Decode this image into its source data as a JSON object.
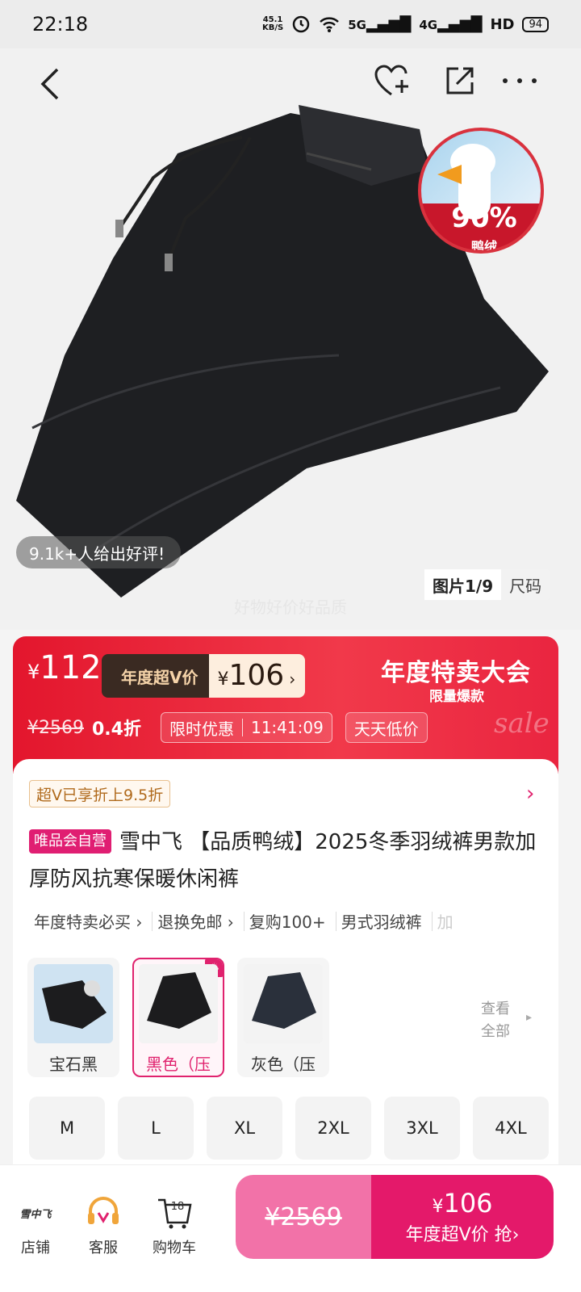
{
  "status_bar": {
    "time": "22:18",
    "net_speed_top": "45.1",
    "net_speed_bottom": "KB/S",
    "signal1": "5G",
    "signal2": "4G",
    "hd": "HD",
    "battery": "94"
  },
  "hero": {
    "review_text": "9.1k+人给出好评!",
    "badge_percent": "90%",
    "badge_text": "鸭绒",
    "tabs": [
      "图片1/9",
      "尺码"
    ],
    "watermark": "好物好价好品质"
  },
  "price": {
    "yen": "¥",
    "current": "112",
    "vip_label": "年度超V价",
    "vip_price": "106",
    "vip_chevron": "›",
    "event_title": "年度特卖大会",
    "event_sub": "限量爆款",
    "event_script": "sale",
    "original": "¥2569",
    "discount": "0.4折",
    "promo_label": "限时优惠",
    "countdown": "11:41:09",
    "promo_tag": "天天低价"
  },
  "product": {
    "vip_discount": "超V已享折上9.5折",
    "store_tag": "唯品会自营",
    "title": "雪中飞 【品质鸭绒】2025冬季羽绒裤男款加厚防风抗寒保暖休闲裤",
    "tags": [
      "年度特卖必买 ›",
      "退换免邮 ›",
      "复购100+",
      "男式羽绒裤",
      "加"
    ],
    "colors": [
      {
        "label": "宝石黑",
        "selected": false
      },
      {
        "label": "黑色（压",
        "selected": true
      },
      {
        "label": "灰色（压",
        "selected": false
      }
    ],
    "view_all": "查看全部",
    "sizes": [
      "M",
      "L",
      "XL",
      "2XL",
      "3XL",
      "4XL"
    ]
  },
  "bottom_bar": {
    "shop_label": "店铺",
    "shop_logo": "雪中飞",
    "service_label": "客服",
    "cart_label": "购物车",
    "cart_count": "18",
    "buy_original": "¥2569",
    "buy_yen": "¥",
    "buy_price": "106",
    "buy_cta": "年度超V价 抢›"
  },
  "colors": {
    "brand_pink": "#e0226e",
    "banner_red": "#e3162d",
    "buy_light": "#f272a8",
    "buy_dark": "#e4196a"
  }
}
